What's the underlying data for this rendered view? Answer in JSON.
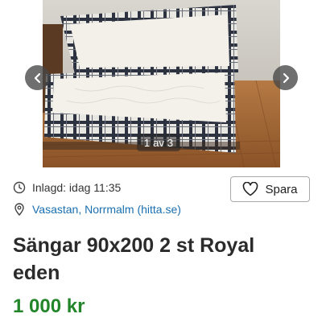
{
  "gallery": {
    "counter_current": "1",
    "counter_sep": "av",
    "counter_total": "3",
    "prev_icon": "chevron-left-icon",
    "next_icon": "chevron-right-icon"
  },
  "listing": {
    "posted_label": "Inlagd: idag 11:35",
    "location_label": "Vasastan, Norrmalm (hitta.se)",
    "save_label": "Spara",
    "title": "Sängar 90x200 2 st Royal eden",
    "price": "1 000 kr"
  },
  "colors": {
    "price": "#23852a",
    "link": "#1a6fb0"
  }
}
